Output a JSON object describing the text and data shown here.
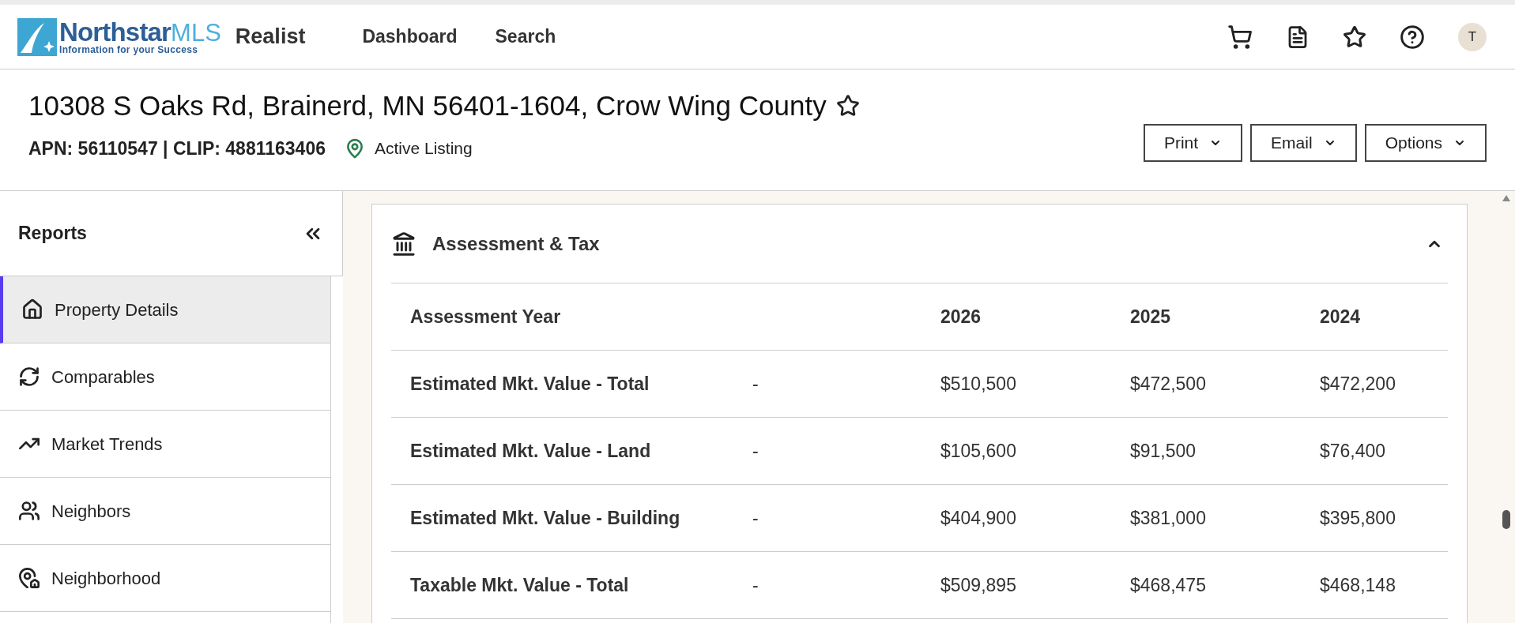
{
  "header": {
    "logo": {
      "name": "Northstar",
      "suffix": "MLS",
      "tagline": "Information for your Success"
    },
    "product": "Realist",
    "nav": [
      {
        "label": "Dashboard"
      },
      {
        "label": "Search"
      }
    ],
    "avatar": "T"
  },
  "property": {
    "address": "10308 S Oaks Rd, Brainerd, MN 56401-1604, Crow Wing County",
    "favorite": false,
    "ids": "APN: 56110547 | CLIP: 4881163406",
    "status": "Active Listing",
    "actions": [
      "Print",
      "Email",
      "Options"
    ]
  },
  "sidebar": {
    "title": "Reports",
    "items": [
      {
        "label": "Property Details",
        "selected": true
      },
      {
        "label": "Comparables",
        "selected": false
      },
      {
        "label": "Market Trends",
        "selected": false
      },
      {
        "label": "Neighbors",
        "selected": false
      },
      {
        "label": "Neighborhood",
        "selected": false
      }
    ]
  },
  "section": {
    "title": "Assessment & Tax",
    "expanded": true,
    "table": {
      "columns": [
        "Assessment Year",
        "",
        "2026",
        "2025",
        "2024"
      ],
      "rows": [
        [
          "Estimated Mkt. Value - Total",
          "-",
          "$510,500",
          "$472,500",
          "$472,200"
        ],
        [
          "Estimated Mkt. Value - Land",
          "-",
          "$105,600",
          "$91,500",
          "$76,400"
        ],
        [
          "Estimated Mkt. Value - Building",
          "-",
          "$404,900",
          "$381,000",
          "$395,800"
        ],
        [
          "Taxable Mkt. Value - Total",
          "-",
          "$509,895",
          "$468,475",
          "$468,148"
        ]
      ]
    }
  }
}
